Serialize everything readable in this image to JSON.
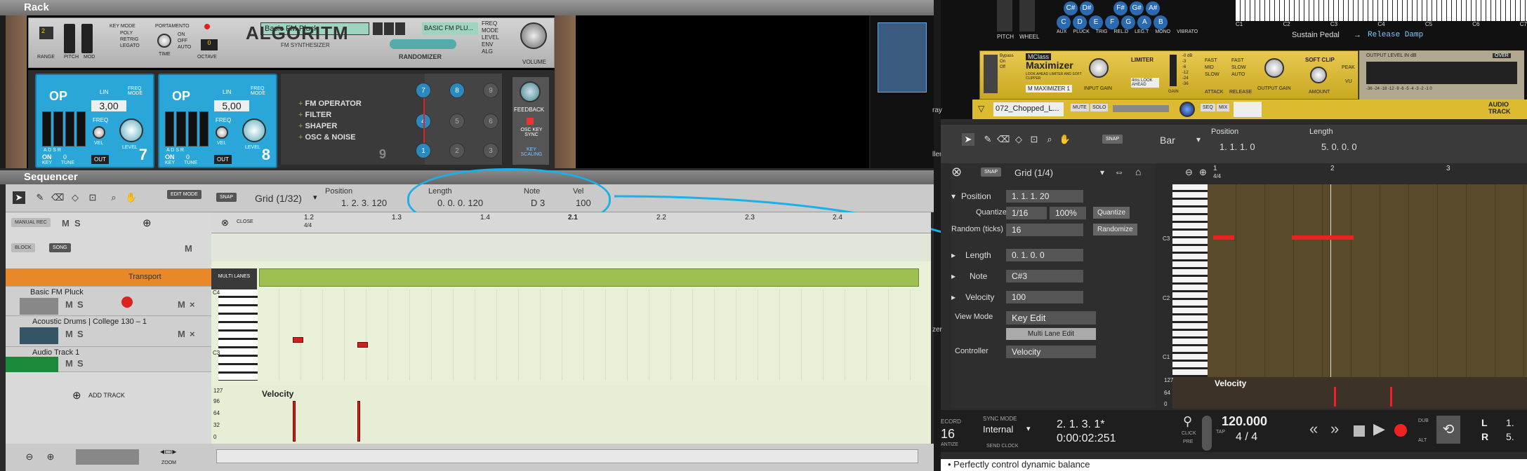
{
  "rack": {
    "title": "Rack",
    "algoritm": {
      "key_mode": "KEY MODE",
      "poly": "POLY",
      "retrig": "RETRIG",
      "legato": "LEGATO",
      "portamento": "PORTAMENTO",
      "on": "ON",
      "off": "OFF",
      "auto": "AUTO",
      "time": "TIME",
      "range": "RANGE",
      "pitch": "PITCH",
      "mod": "MOD",
      "octave": "OCTAVE",
      "octave_val": "0",
      "range_val": "2",
      "preset": "Basic FM Pluck",
      "logo": "ALGORITM",
      "subtitle": "FM SYNTHESIZER",
      "display": "BASIC FM PLU...",
      "randomizer": "RANDOMIZER",
      "volume": "VOLUME",
      "mod_targets": [
        "FREQ",
        "MODE",
        "LEVEL",
        "ENV",
        "ALG"
      ],
      "operators": [
        {
          "label": "OP",
          "freq": "3,00",
          "num": "7",
          "lin": "LIN",
          "freq_mode": "FREQ MODE",
          "freq_lbl": "FREQ",
          "vel": "VEL",
          "level": "LEVEL",
          "on": "ON",
          "key": "KEY",
          "tune_val": "0",
          "tune": "TUNE",
          "out": "OUT",
          "adsr": "A D S R"
        },
        {
          "label": "OP",
          "freq": "5,00",
          "num": "8",
          "lin": "LIN",
          "freq_mode": "FREQ MODE",
          "freq_lbl": "FREQ",
          "vel": "VEL",
          "level": "LEVEL",
          "on": "ON",
          "key": "KEY",
          "tune_val": "0",
          "tune": "TUNE",
          "out": "OUT",
          "adsr": "A D S R"
        }
      ],
      "mods": [
        "FM OPERATOR",
        "FILTER",
        "SHAPER",
        "OSC & NOISE"
      ],
      "mod_num": "9",
      "nodes": [
        "7",
        "8",
        "9",
        "4",
        "5",
        "6",
        "1",
        "2",
        "3"
      ],
      "feedback": "FEEDBACK",
      "osc_key_sync": "OSC KEY SYNC",
      "key_scaling": "KEY SCALING"
    }
  },
  "sequencer": {
    "title": "Sequencer",
    "edit_mode": "EDIT MODE",
    "snap": "SNAP",
    "grid": "Grid (1/32)",
    "position_label": "Position",
    "position": "1.  2.  3. 120",
    "length_label": "Length",
    "length": "0.  0.  0. 120",
    "note_label": "Note",
    "note": "D 3",
    "vel_label": "Vel",
    "vel": "100",
    "manual_rec": "MANUAL REC",
    "block": "BLOCK",
    "song": "SONG",
    "m": "M",
    "s": "S",
    "close": "CLOSE",
    "ruler": [
      "1.2",
      "1.3",
      "1.4",
      "2.1",
      "2.2",
      "2.3",
      "2.4"
    ],
    "ts": "4/4",
    "multi_lanes": "MULTI LANES",
    "transport": "Transport",
    "tracks": [
      "Basic FM Pluck",
      "Acoustic Drums | College  130 – 1",
      "Audio Track 1"
    ],
    "add_track": "ADD TRACK",
    "velocity": "Velocity",
    "vel_ticks": [
      "127",
      "96",
      "64",
      "32",
      "0"
    ],
    "c4": "C4",
    "c3": "C3",
    "zoom": "ZOOM"
  },
  "right": {
    "pitch": "PITCH",
    "wheel": "WHEEL",
    "keys_top": [
      "C#",
      "D#",
      "F#",
      "G#",
      "A#"
    ],
    "keys_bot": [
      "C",
      "D",
      "E",
      "F",
      "G",
      "A",
      "B"
    ],
    "knob_labels": [
      "AUX",
      "PLUCK",
      "TRIG",
      "REL.D",
      "LEG.T",
      "MONO",
      "VIBRATO"
    ],
    "octave_labels": [
      "C1",
      "C2",
      "C3",
      "C4",
      "C5",
      "C6",
      "C7"
    ],
    "sustain": "Sustain Pedal",
    "release_damp": "Release Damp",
    "maximizer": "Maximizer",
    "mclass": "MClass",
    "max_sub": "LOOK AHEAD LIMITER AND SOFT CLIPPER",
    "max_name": "M MAXIMIZER 1",
    "bypass": "Bypass",
    "on": "On",
    "off": "Off",
    "input_gain": "INPUT GAIN",
    "limiter": "LIMITER",
    "look_ahead": "4ms LOOK AHEAD",
    "gain": "GAIN",
    "attack": "ATTACK",
    "fast": "FAST",
    "mid": "MID",
    "slow": "SLOW",
    "release": "RELEASE",
    "auto": "AUTO",
    "output_gain": "OUTPUT GAIN",
    "soft_clip": "SOFT CLIP",
    "amount": "AMOUNT",
    "peak": "PEAK",
    "vu": "VU",
    "output_level": "OUTPUT LEVEL IN dB",
    "over": "OVER",
    "meter_db": [
      "-0 dB",
      "-3",
      "-6",
      "-12",
      "-24",
      "-36"
    ],
    "meter_scale": "-36 -24 -18 -12 -9 -6 -5 -4 -3 -2 -1 0",
    "track_name": "072_Chopped_L...",
    "mute": "MUTE",
    "solo": "SOLO",
    "seq": "SEQ",
    "mix": "MIX",
    "audio_track": "AUDIO TRACK",
    "snap": "SNAP",
    "bar": "Bar",
    "position_label": "Position",
    "position": "1.  1.  1.  0",
    "length_label": "Length",
    "length": "5.  0.  0.  0",
    "grid": "Grid (1/4)",
    "ruler": [
      "1",
      "2",
      "3"
    ],
    "ts": "4/4",
    "insp_position": "Position",
    "insp_position_val": "1.  1.  1.  20",
    "quantize": "Quantize",
    "quantize_val": "1/16",
    "quantize_pct": "100%",
    "quantize_btn": "Quantize",
    "random_ticks": "Random (ticks)",
    "random_val": "16",
    "randomize": "Randomize",
    "insp_length": "Length",
    "insp_length_val": "0.  1.  0.  0",
    "insp_note": "Note",
    "insp_note_val": "C#3",
    "insp_velocity": "Velocity",
    "insp_velocity_val": "100",
    "view_mode": "View Mode",
    "key_edit": "Key Edit",
    "multi_lane_edit": "Multi Lane Edit",
    "controller": "Controller",
    "controller_val": "Velocity",
    "piano_c3": "C3",
    "piano_c2": "C2",
    "piano_c1": "C1",
    "vel_label": "Velocity",
    "vel_ticks": [
      "127",
      "64",
      "0"
    ],
    "record": "ECORD",
    "sync_mode": "SYNC MODE",
    "sync_val": "Internal",
    "send_clock": "SEND CLOCK",
    "sig": "16",
    "tize": "ANTIZE",
    "bars": "2.  1.  3.  1*",
    "time": "0:00:02:251",
    "click": "CLICK",
    "pre": "PRE",
    "tempo": "120.000",
    "tap": "TAP",
    "meter": "4 / 4",
    "dub": "DUB",
    "alt": "ALT",
    "l": "L",
    "r": "R",
    "l_val": "1.",
    "r_val": "5.",
    "side_labels": [
      "ray",
      "ller",
      "zer"
    ],
    "bullet": "• Perfectly control dynamic balance"
  },
  "colors": {
    "accent": "#1ab0e8",
    "note": "#d02020",
    "op_blue": "#2aa7d8",
    "maximizer_gold": "#ddbb30"
  }
}
